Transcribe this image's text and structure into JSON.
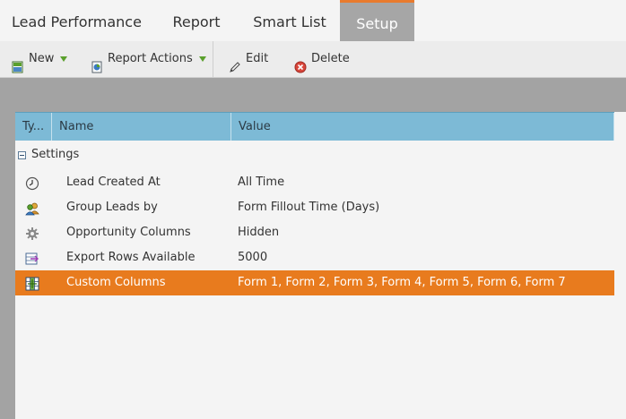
{
  "tabs": [
    {
      "label": "Lead Performance",
      "active": false
    },
    {
      "label": "Report",
      "active": false
    },
    {
      "label": "Smart List",
      "active": false
    },
    {
      "label": "Setup",
      "active": true
    }
  ],
  "toolbar": {
    "new_label": "New",
    "report_actions_label": "Report Actions",
    "edit_label": "Edit",
    "delete_label": "Delete"
  },
  "grid": {
    "columns": [
      "Ty...",
      "Name",
      "Value"
    ],
    "group_label": "Settings",
    "rows": [
      {
        "icon": "clock-icon",
        "name": "Lead Created At",
        "value": "All Time",
        "selected": false
      },
      {
        "icon": "people-icon",
        "name": "Group Leads by",
        "value": "Form Fillout Time (Days)",
        "selected": false
      },
      {
        "icon": "gear-icon",
        "name": "Opportunity Columns",
        "value": "Hidden",
        "selected": false
      },
      {
        "icon": "export-rows-icon",
        "name": "Export Rows Available",
        "value": "5000",
        "selected": false
      },
      {
        "icon": "custom-columns-icon",
        "name": "Custom Columns",
        "value": "Form 1, Form 2, Form 3, Form 4, Form 5, Form 6, Form 7",
        "selected": true
      }
    ]
  },
  "colors": {
    "accent": "#e87b1e",
    "header": "#7dbad6"
  }
}
